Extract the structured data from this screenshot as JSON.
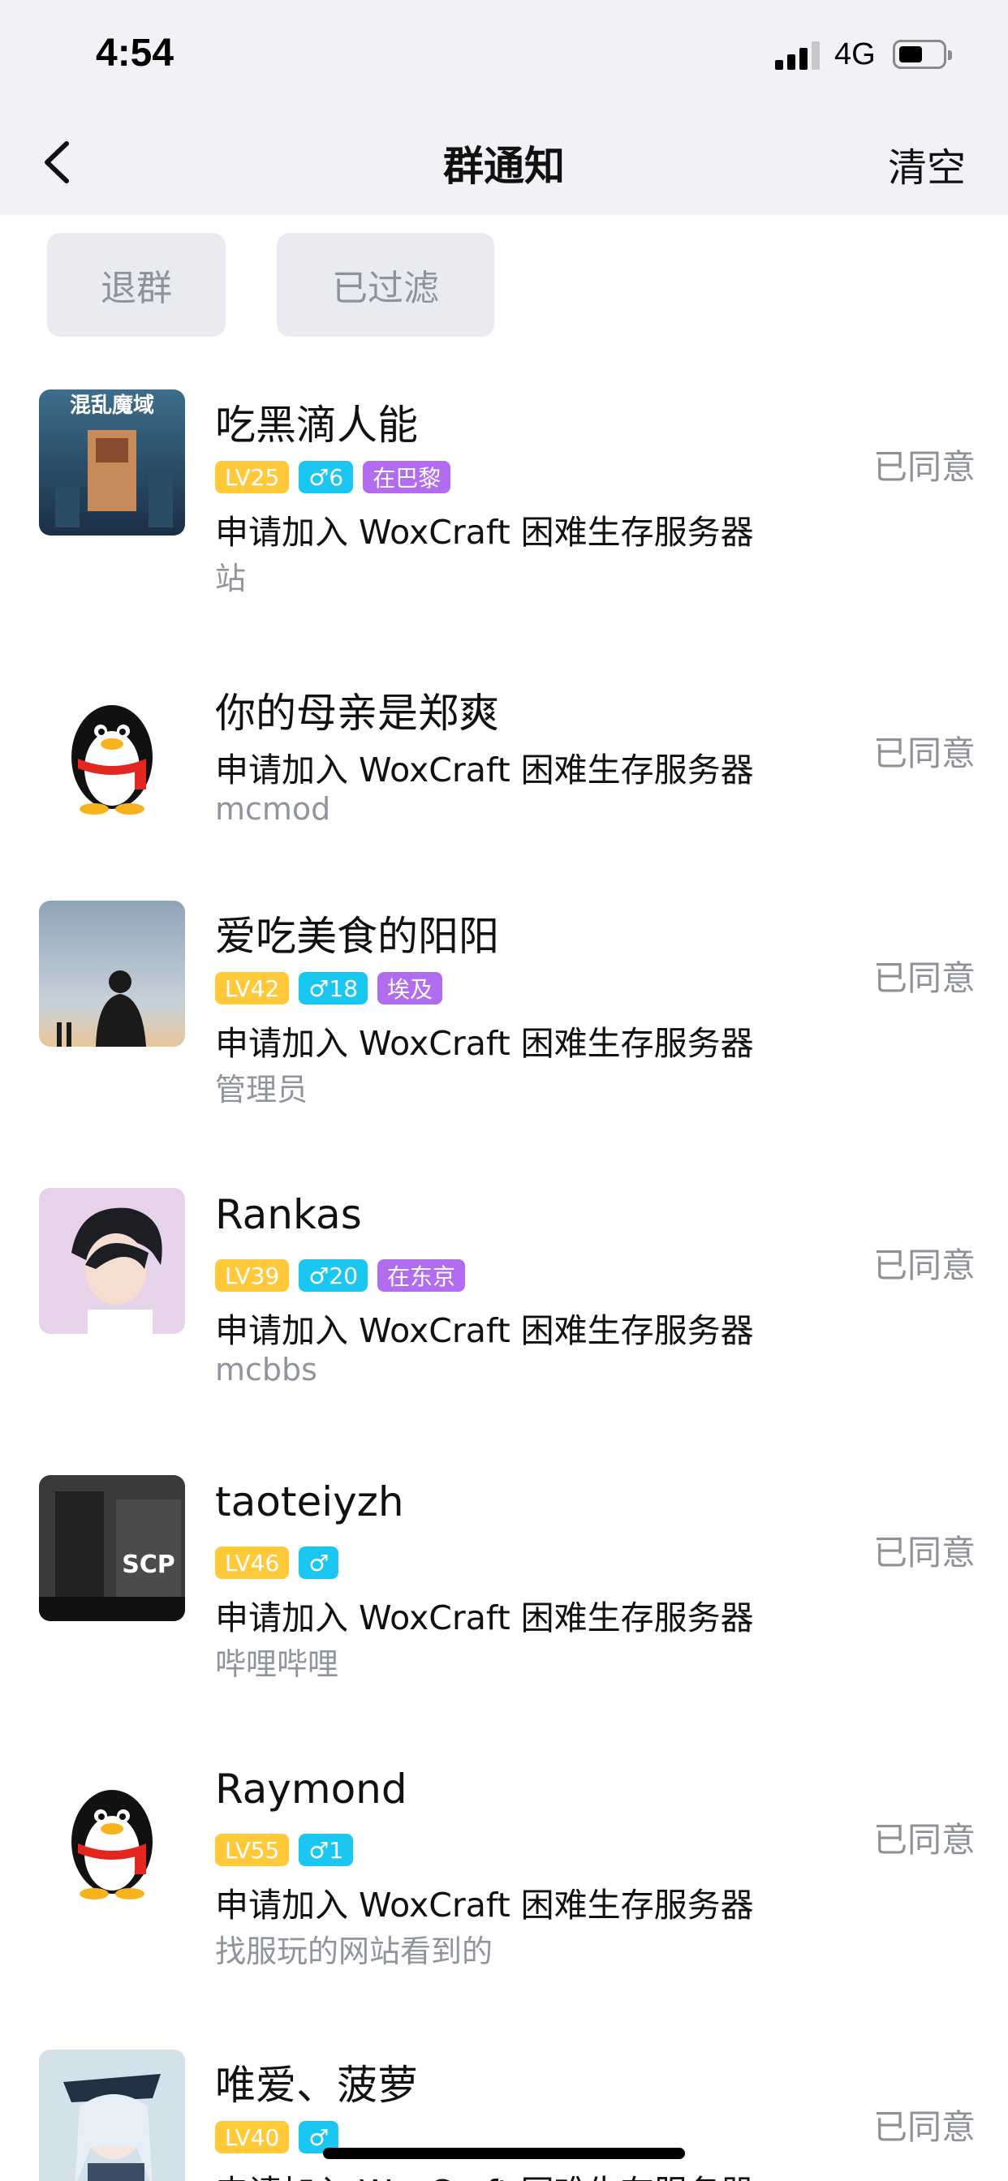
{
  "status_bar": {
    "time": "4:54",
    "network": "4G"
  },
  "header": {
    "title": "群通知",
    "clear_label": "清空"
  },
  "filters": [
    {
      "label": "退群"
    },
    {
      "label": "已过滤"
    }
  ],
  "requests": [
    {
      "name": "吃黑滴人能",
      "avatar": "minecraft-poster-avatar",
      "level": "LV25",
      "gender_age": "♂6",
      "location": "在巴黎",
      "request_text": "申请加入 WoxCraft 困难生存服务器",
      "message": "站",
      "status": "已同意"
    },
    {
      "name": "你的母亲是郑爽",
      "avatar": "qq-penguin-avatar",
      "request_text": "申请加入 WoxCraft 困难生存服务器",
      "message": "mcmod",
      "status": "已同意"
    },
    {
      "name": "爱吃美食的阳阳",
      "avatar": "sky-silhouette-avatar",
      "level": "LV42",
      "gender_age": "♂18",
      "location": "埃及",
      "request_text": "申请加入 WoxCraft 困难生存服务器",
      "message": "管理员",
      "status": "已同意"
    },
    {
      "name": "Rankas",
      "avatar": "anime-character-avatar",
      "level": "LV39",
      "gender_age": "♂20",
      "location": "在东京",
      "request_text": "申请加入 WoxCraft 困难生存服务器",
      "message": "mcbbs",
      "status": "已同意"
    },
    {
      "name": "taoteiyzh",
      "avatar": "scp-soldier-avatar",
      "level": "LV46",
      "gender_age": "♂",
      "request_text": "申请加入 WoxCraft 困难生存服务器",
      "message": "哔哩哔哩",
      "status": "已同意"
    },
    {
      "name": "Raymond",
      "avatar": "qq-penguin-avatar",
      "level": "LV55",
      "gender_age": "♂1",
      "request_text": "申请加入 WoxCraft 困难生存服务器",
      "message": "找服玩的网站看到的",
      "status": "已同意"
    },
    {
      "name": "唯爱、菠萝",
      "avatar": "anime-sailor-avatar",
      "level": "LV40",
      "gender_age": "♂",
      "request_text": "申请加入 WoxCraft 困难生存服务器",
      "status": "已同意"
    }
  ],
  "colors": {
    "level_tag": "#ffc93a",
    "gender_tag": "#1ac7f0",
    "location_tag": "#b26cf0",
    "header_bg": "#f1f2f6"
  }
}
